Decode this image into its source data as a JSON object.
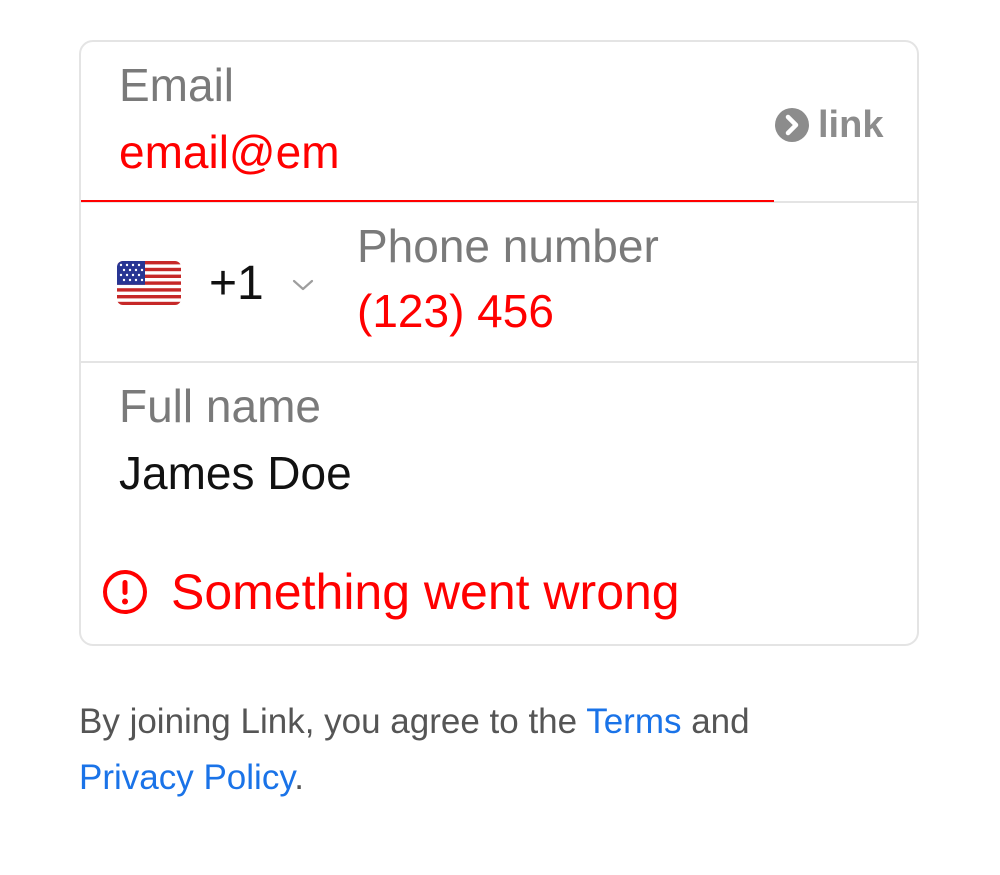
{
  "colors": {
    "error": "#ff0000",
    "label": "#7a7a7a",
    "link": "#1a73e8",
    "border": "#e4e4e4",
    "text": "#111111",
    "muted": "#555555"
  },
  "email": {
    "label": "Email",
    "value": "email@em",
    "state": "error"
  },
  "link_badge": {
    "icon": "chevron-circle-icon",
    "text": "link"
  },
  "phone": {
    "flag": "us-flag-icon",
    "dial_code": "+1",
    "label": "Phone number",
    "value": "(123) 456",
    "state": "error"
  },
  "name": {
    "label": "Full name",
    "value": "James Doe"
  },
  "error": {
    "icon": "alert-circle-icon",
    "message": "Something went wrong"
  },
  "legal": {
    "prefix": "By joining Link, you agree to the ",
    "terms": "Terms",
    "and": " and ",
    "privacy": "Privacy Policy",
    "suffix": "."
  }
}
